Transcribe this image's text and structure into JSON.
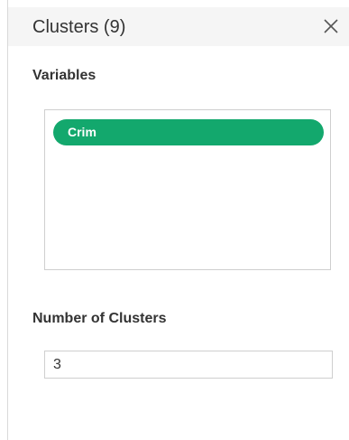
{
  "header": {
    "title": "Clusters (9)",
    "close_icon": "close-icon"
  },
  "variables": {
    "label": "Variables",
    "items": [
      {
        "label": "Crim",
        "color": "#13a86d"
      }
    ]
  },
  "number_of_clusters": {
    "label": "Number of Clusters",
    "value": "3"
  }
}
